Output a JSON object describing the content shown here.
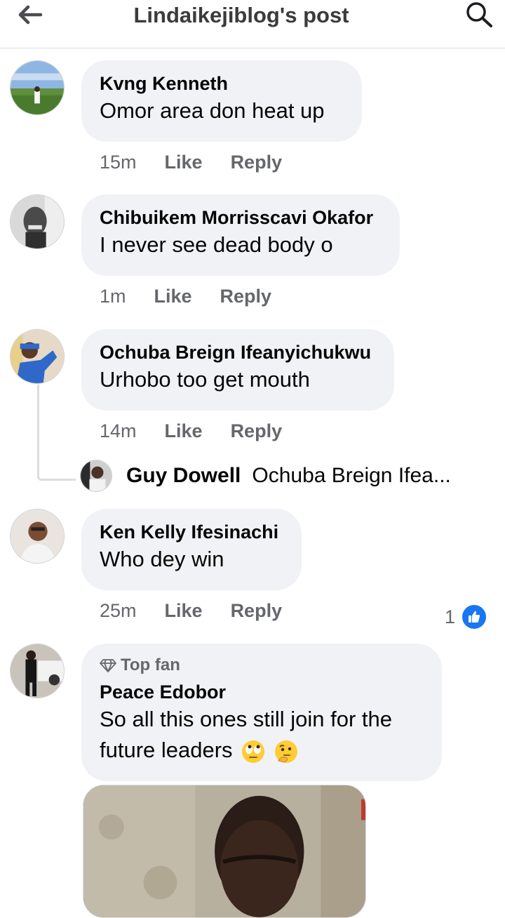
{
  "header": {
    "title": "Lindaikejiblog's post",
    "back_icon": "arrow-left-icon",
    "search_icon": "search-icon"
  },
  "comments": [
    {
      "author": "Kvng Kenneth",
      "text": "Omor area don heat up",
      "time": "15m",
      "like": "Like",
      "reply": "Reply"
    },
    {
      "author": "Chibuikem Morrisscavi Okafor",
      "text": "I never see dead body o",
      "time": "1m",
      "like": "Like",
      "reply": "Reply"
    },
    {
      "author": "Ochuba Breign Ifeanyichukwu",
      "text": "Urhobo too get mouth",
      "time": "14m",
      "like": "Like",
      "reply": "Reply",
      "reply_preview": {
        "author": "Guy Dowell",
        "text": "Ochuba Breign Ifea..."
      }
    },
    {
      "author": "Ken Kelly Ifesinachi",
      "text": "Who dey win",
      "time": "25m",
      "like": "Like",
      "reply": "Reply",
      "reaction_count": "1",
      "reaction_icon": "like-icon"
    },
    {
      "badge": "Top fan",
      "author": "Peace Edobor",
      "text_line1": "So all this ones still join for the",
      "text_line2": "future leaders",
      "emojis": [
        "face-with-rolling-eyes",
        "thinking-face"
      ]
    }
  ],
  "colors": {
    "accent": "#1877f2",
    "bubble": "#f0f2f5",
    "secondary_text": "#65676b"
  }
}
